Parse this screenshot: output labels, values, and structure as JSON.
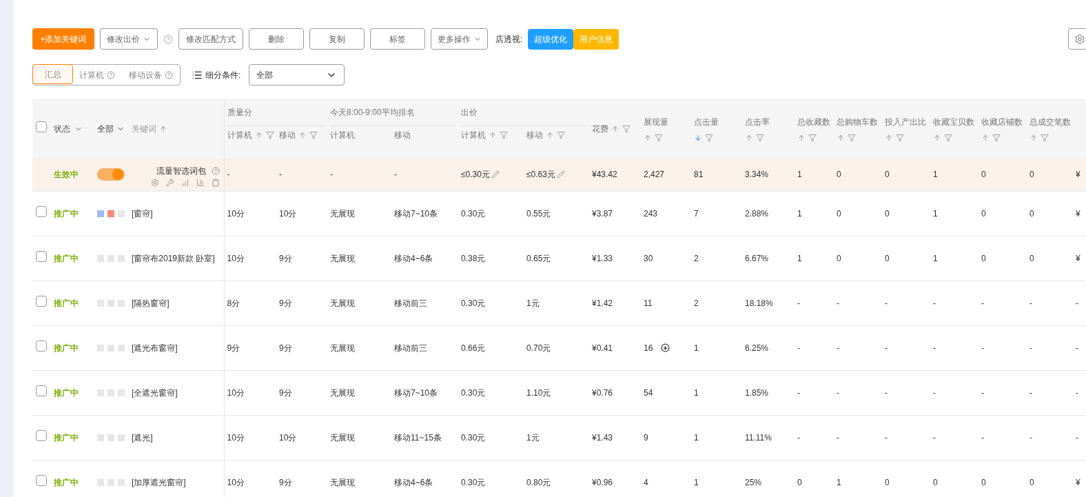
{
  "toolbar": {
    "add_button": "+添加关键词",
    "bid_menu": "修改出价",
    "match_button": "修改匹配方式",
    "delete_button": "删除",
    "copy_button": "复制",
    "tag_button": "标签",
    "more_menu": "更多操作",
    "insight_label": "店透视:",
    "insight_buttons": [
      {
        "label": "超级优化",
        "color": "#1e9fff"
      },
      {
        "label": "用户信息",
        "color": "#ffb800"
      }
    ]
  },
  "device_tabs": [
    {
      "label": "汇总",
      "selected": true,
      "help": false
    },
    {
      "label": "计算机",
      "selected": false,
      "help": true
    },
    {
      "label": "移动设备",
      "selected": false,
      "help": true
    }
  ],
  "segment": {
    "label": "细分条件:",
    "value": "全部"
  },
  "header": {
    "all_checked": false,
    "status": "状态",
    "scope": "全部",
    "keyword": "关键词"
  },
  "columns": [
    {
      "kind": "group",
      "label": "质量分",
      "sub": [
        {
          "label": "计算机",
          "sortable": true,
          "sort_desc": false,
          "filter": true
        },
        {
          "label": "移动",
          "sortable": true,
          "sort_desc": false,
          "filter": true
        }
      ]
    },
    {
      "kind": "group",
      "label": "今天8:00-9:00平均排名",
      "sub": [
        {
          "label": "计算机",
          "sortable": false,
          "filter": false
        },
        {
          "label": "移动",
          "sortable": false,
          "filter": false
        }
      ]
    },
    {
      "kind": "group",
      "label": "出价",
      "sub": [
        {
          "label": "计算机",
          "sortable": true,
          "sort_desc": false,
          "filter": true
        },
        {
          "label": "移动",
          "sortable": true,
          "sort_desc": false,
          "filter": true
        }
      ]
    },
    {
      "kind": "inline",
      "label": "花费",
      "sortable": true,
      "sort_desc": false,
      "filter": true
    },
    {
      "kind": "stacked",
      "label": "展现量",
      "sortable": true,
      "sort_desc": false,
      "filter": true
    },
    {
      "kind": "stacked",
      "label": "点击量",
      "sortable": true,
      "sort_desc": true,
      "filter": true
    },
    {
      "kind": "stacked",
      "label": "点击率",
      "sortable": true,
      "sort_desc": false,
      "filter": true
    },
    {
      "kind": "stacked",
      "label": "总收藏数",
      "sortable": true,
      "sort_desc": false,
      "filter": true
    },
    {
      "kind": "stacked",
      "label": "总购物车数",
      "sortable": true,
      "sort_desc": false,
      "filter": true
    },
    {
      "kind": "stacked",
      "label": "投入产出比",
      "sortable": true,
      "sort_desc": false,
      "filter": true
    },
    {
      "kind": "stacked",
      "label": "收藏宝贝数",
      "sortable": true,
      "sort_desc": false,
      "filter": true
    },
    {
      "kind": "stacked",
      "label": "收藏店铺数",
      "sortable": true,
      "sort_desc": false,
      "filter": true
    },
    {
      "kind": "stacked",
      "label": "总成交笔数",
      "sortable": true,
      "sort_desc": false,
      "filter": true
    },
    {
      "kind": "blank"
    }
  ],
  "summary": {
    "status": "生效中",
    "on": true,
    "name": "流量智选词包",
    "cells": [
      {
        "text": "-",
        "editable": false
      },
      {
        "text": "-",
        "editable": false
      },
      {
        "text": "-",
        "editable": false
      },
      {
        "text": "-",
        "editable": false
      },
      {
        "text": "≤0.30元",
        "editable": true
      },
      {
        "text": "≤0.63元",
        "editable": true
      },
      {
        "text": "¥43.42",
        "editable": false
      },
      {
        "text": "2,427",
        "editable": false
      },
      {
        "text": "81",
        "editable": false
      },
      {
        "text": "3.34%",
        "editable": false
      },
      {
        "text": "1",
        "editable": false
      },
      {
        "text": "0",
        "editable": false
      },
      {
        "text": "0",
        "editable": false
      },
      {
        "text": "1",
        "editable": false
      },
      {
        "text": "0",
        "editable": false
      },
      {
        "text": "0",
        "editable": false
      },
      {
        "text": "¥",
        "editable": false
      }
    ]
  },
  "rows": [
    {
      "checked": false,
      "status": "推广中",
      "marks": [
        {
          "color": "#a5b9f3"
        },
        {
          "color": "#f98a7c"
        },
        {
          "color": "#e6e6e6"
        }
      ],
      "keyword": "[窗帘]",
      "alert": false,
      "cells": [
        "10分",
        "10分",
        "无展现",
        "移动7~10条",
        "0.30元",
        "0.55元",
        "¥3.87",
        "243",
        "7",
        "2.88%",
        "1",
        "0",
        "0",
        "1",
        "0",
        "0",
        "¥"
      ]
    },
    {
      "checked": false,
      "status": "推广中",
      "marks": [
        {
          "color": "#e6e6e6"
        },
        {
          "color": "#e6e6e6"
        },
        {
          "color": "#e6e6e6"
        }
      ],
      "keyword": "[窗帘布2019新款 卧室]",
      "alert": false,
      "cells": [
        "10分",
        "9分",
        "无展现",
        "移动4~6条",
        "0.38元",
        "0.65元",
        "¥1.33",
        "30",
        "2",
        "6.67%",
        "1",
        "0",
        "0",
        "1",
        "0",
        "0",
        "¥"
      ]
    },
    {
      "checked": false,
      "status": "推广中",
      "marks": [
        {
          "color": "#e6e6e6"
        },
        {
          "color": "#e6e6e6"
        },
        {
          "color": "#e6e6e6"
        }
      ],
      "keyword": "[隔热窗帘]",
      "alert": false,
      "cells": [
        "8分",
        "9分",
        "无展现",
        "移动前三",
        "0.30元",
        "1元",
        "¥1.42",
        "11",
        "2",
        "18.18%",
        "-",
        "-",
        "-",
        "-",
        "-",
        "-",
        "-"
      ]
    },
    {
      "checked": false,
      "status": "推广中",
      "marks": [
        {
          "color": "#e6e6e6"
        },
        {
          "color": "#e6e6e6"
        },
        {
          "color": "#e6e6e6"
        }
      ],
      "keyword": "[遮光布窗帘]",
      "alert": true,
      "cells": [
        "9分",
        "9分",
        "无展现",
        "移动前三",
        "0.66元",
        "0.70元",
        "¥0.41",
        "16",
        "1",
        "6.25%",
        "-",
        "-",
        "-",
        "-",
        "-",
        "-",
        "-"
      ]
    },
    {
      "checked": false,
      "status": "推广中",
      "marks": [
        {
          "color": "#e6e6e6"
        },
        {
          "color": "#e6e6e6"
        },
        {
          "color": "#e6e6e6"
        }
      ],
      "keyword": "[全遮光窗帘]",
      "alert": false,
      "cells": [
        "10分",
        "9分",
        "无展现",
        "移动7~10条",
        "0.30元",
        "1.10元",
        "¥0.76",
        "54",
        "1",
        "1.85%",
        "-",
        "-",
        "-",
        "-",
        "-",
        "-",
        "-"
      ]
    },
    {
      "checked": false,
      "status": "推广中",
      "marks": [
        {
          "color": "#e6e6e6"
        },
        {
          "color": "#e6e6e6"
        },
        {
          "color": "#e6e6e6"
        }
      ],
      "keyword": "[遮光]",
      "alert": false,
      "cells": [
        "10分",
        "10分",
        "无展现",
        "移动11~15条",
        "0.30元",
        "1元",
        "¥1.43",
        "9",
        "1",
        "11.11%",
        "-",
        "-",
        "-",
        "-",
        "-",
        "-",
        "-"
      ]
    },
    {
      "checked": false,
      "status": "推广中",
      "marks": [
        {
          "color": "#e6e6e6"
        },
        {
          "color": "#e6e6e6"
        },
        {
          "color": "#e6e6e6"
        }
      ],
      "keyword": "[加厚遮光窗帘]",
      "alert": false,
      "cells": [
        "10分",
        "9分",
        "无展现",
        "移动4~6条",
        "0.30元",
        "0.80元",
        "¥0.96",
        "4",
        "1",
        "25%",
        "0",
        "1",
        "0",
        "0",
        "0",
        "0",
        "¥"
      ]
    }
  ]
}
